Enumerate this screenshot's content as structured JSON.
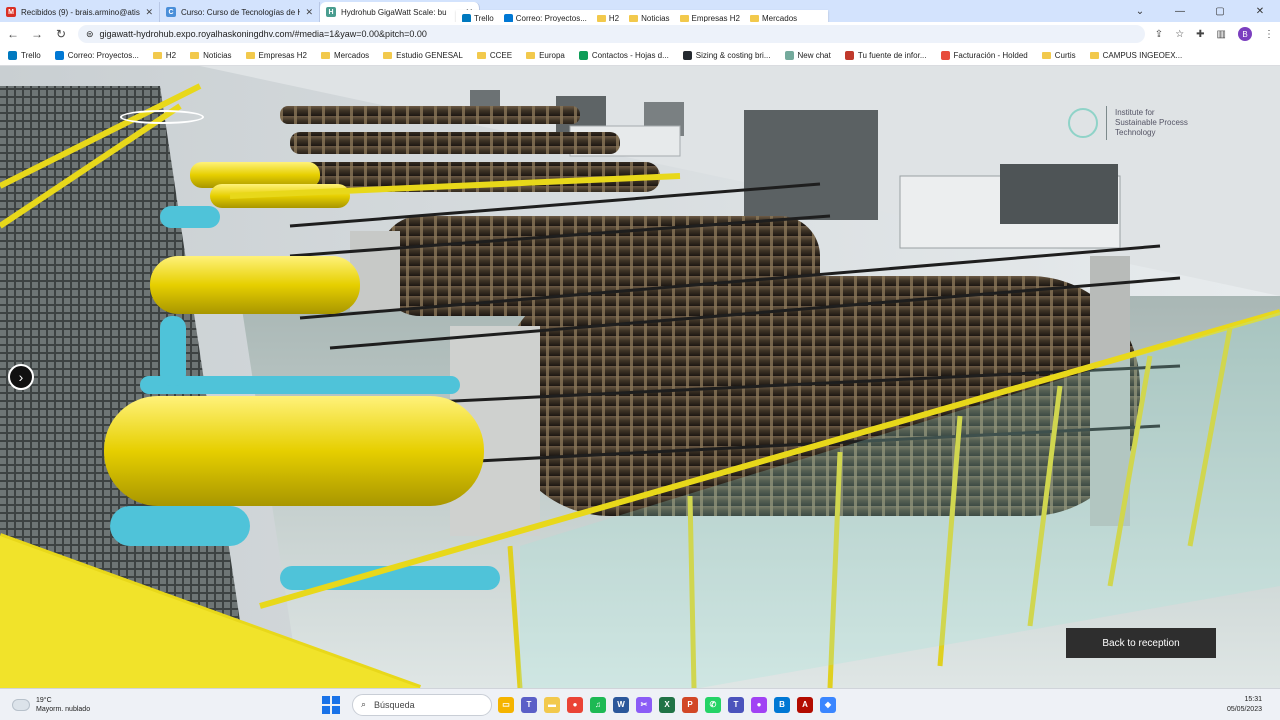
{
  "tabs": [
    {
      "title": "Recibidos (9) - brais.armino@atis",
      "icon": "gmail-icon",
      "color": "#d93025",
      "glyph": "M",
      "active": false
    },
    {
      "title": "Curso: Curso de Tecnologías de H",
      "icon": "course-icon",
      "color": "#4a8fd9",
      "glyph": "C",
      "active": false
    },
    {
      "title": "Hydrohub GigaWatt Scale: bu",
      "icon": "hydrohub-icon",
      "color": "#4a9d8f",
      "glyph": "H",
      "active": true
    }
  ],
  "popup_bookmarks": [
    {
      "label": "Trello",
      "type": "site",
      "color": "#0079bf"
    },
    {
      "label": "Correo: Proyectos...",
      "type": "site",
      "color": "#0078d4"
    },
    {
      "label": "H2",
      "type": "folder"
    },
    {
      "label": "Noticias",
      "type": "folder"
    },
    {
      "label": "Empresas H2",
      "type": "folder"
    },
    {
      "label": "Mercados",
      "type": "folder"
    }
  ],
  "address": {
    "url": "gigawatt-hydrohub.expo.royalhaskoningdhv.com/#media=1&yaw=0.00&pitch=0.00"
  },
  "bookmarks": [
    {
      "label": "Trello",
      "type": "site",
      "color": "#0079bf"
    },
    {
      "label": "Correo: Proyectos...",
      "type": "site",
      "color": "#0078d4"
    },
    {
      "label": "H2",
      "type": "folder"
    },
    {
      "label": "Noticias",
      "type": "folder"
    },
    {
      "label": "Empresas H2",
      "type": "folder"
    },
    {
      "label": "Mercados",
      "type": "folder"
    },
    {
      "label": "Estudio GENESAL",
      "type": "folder"
    },
    {
      "label": "CCEE",
      "type": "folder"
    },
    {
      "label": "Europa",
      "type": "folder"
    },
    {
      "label": "Contactos - Hojas d...",
      "type": "site",
      "color": "#0f9d58"
    },
    {
      "label": "Sizing & costing bri...",
      "type": "site",
      "color": "#24292f"
    },
    {
      "label": "New chat",
      "type": "site",
      "color": "#74aa9c"
    },
    {
      "label": "Tu fuente de infor...",
      "type": "site",
      "color": "#c0392b"
    },
    {
      "label": "Facturación - Holded",
      "type": "site",
      "color": "#e74c3c"
    },
    {
      "label": "Curtis",
      "type": "folder"
    },
    {
      "label": "CAMPUS INGEOEX...",
      "type": "folder"
    }
  ],
  "viewer": {
    "brand_text": "Institute for Sustainable Process Technology",
    "back_button": "Back to reception",
    "nav_arrow": "›"
  },
  "taskbar": {
    "temperature": "19°C",
    "weather": "Mayorm. nublado",
    "search_placeholder": "Búsqueda",
    "time": "15:31",
    "date": "05/05/2023",
    "apps": [
      {
        "name": "file-explorer-icon",
        "color": "#f5b400",
        "glyph": "▭"
      },
      {
        "name": "teams-icon",
        "color": "#5b5fc7",
        "glyph": "T"
      },
      {
        "name": "folder-icon",
        "color": "#f2c94c",
        "glyph": "▬"
      },
      {
        "name": "chrome-icon",
        "color": "#ea4335",
        "glyph": "●"
      },
      {
        "name": "spotify-icon",
        "color": "#1db954",
        "glyph": "♫"
      },
      {
        "name": "word-icon",
        "color": "#2b579a",
        "glyph": "W"
      },
      {
        "name": "snip-icon",
        "color": "#8b5cf6",
        "glyph": "✂"
      },
      {
        "name": "excel-icon",
        "color": "#217346",
        "glyph": "X"
      },
      {
        "name": "powerpoint-icon",
        "color": "#d24726",
        "glyph": "P"
      },
      {
        "name": "whatsapp-icon",
        "color": "#25d366",
        "glyph": "✆"
      },
      {
        "name": "teams-work-icon",
        "color": "#4b53bc",
        "glyph": "T"
      },
      {
        "name": "chrome-profile-icon",
        "color": "#a142f4",
        "glyph": "●"
      },
      {
        "name": "bi-icon",
        "color": "#0078d4",
        "glyph": "B"
      },
      {
        "name": "acrobat-icon",
        "color": "#b30b00",
        "glyph": "A"
      },
      {
        "name": "paint-icon",
        "color": "#3a86ff",
        "glyph": "◆"
      }
    ]
  }
}
